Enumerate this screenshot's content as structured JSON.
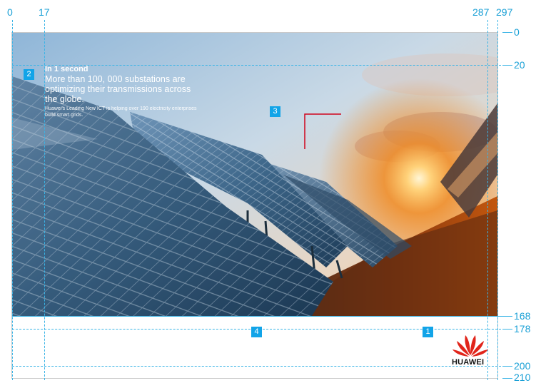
{
  "ruler_top": [
    "0",
    "17",
    "287",
    "297"
  ],
  "ruler_right": [
    "0",
    "20",
    "168",
    "178",
    "200",
    "210"
  ],
  "badges": [
    "1",
    "2",
    "3",
    "4"
  ],
  "headline": {
    "title": "In 1 second",
    "body": "More than 100, 000 substations are optimizing their transmissions across the globe.",
    "caption": "Huawei's Leading New ICT is helping over 190 electricity enterprises build smart grids."
  },
  "logo": {
    "text": "HUAWEI",
    "color": "#e1251b"
  },
  "colors": {
    "guide": "#3ab4e6",
    "badge": "#12a4e8",
    "corner_mark": "#d0021b"
  }
}
